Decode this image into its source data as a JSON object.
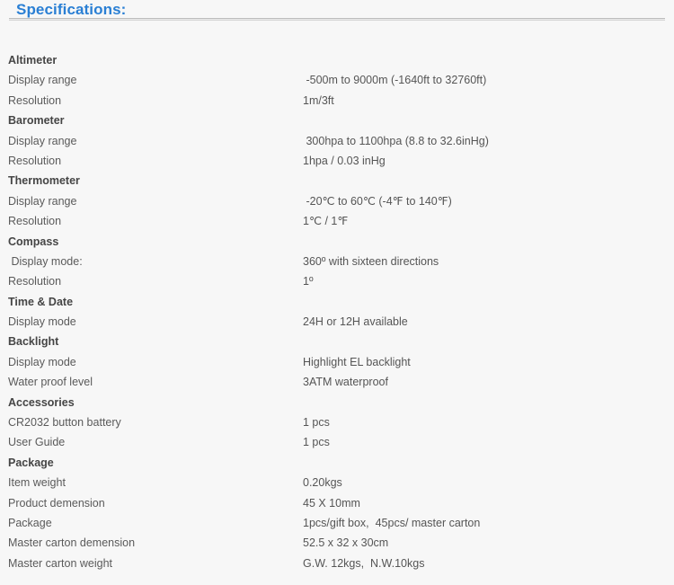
{
  "header": {
    "title": "Specifications:",
    "accent_color": "#2a7fd4",
    "rule_color": "#bdbdbd"
  },
  "colors": {
    "background": "#f7f7f7",
    "section_text": "#454545",
    "label_text": "#5a5a5a",
    "value_text": "#555555"
  },
  "spec_rows": [
    {
      "type": "section",
      "label": "Altimeter",
      "value": ""
    },
    {
      "type": "item",
      "label": "Display range",
      "value": " -500m to 9000m (-1640ft to 32760ft)"
    },
    {
      "type": "item",
      "label": "Resolution",
      "value": "1m/3ft"
    },
    {
      "type": "section",
      "label": "Barometer",
      "value": ""
    },
    {
      "type": "item",
      "label": "Display range",
      "value": " 300hpa to 1100hpa (8.8 to 32.6inHg)"
    },
    {
      "type": "item",
      "label": "Resolution",
      "value": "1hpa / 0.03 inHg"
    },
    {
      "type": "section",
      "label": "Thermometer",
      "value": ""
    },
    {
      "type": "item",
      "label": "Display range",
      "value": " -20℃ to 60℃ (-4℉ to 140℉)"
    },
    {
      "type": "item",
      "label": "Resolution",
      "value": "1℃ / 1℉"
    },
    {
      "type": "section",
      "label": "Compass",
      "value": ""
    },
    {
      "type": "item",
      "label": " Display mode:",
      "value": "360º with sixteen directions"
    },
    {
      "type": "item",
      "label": "Resolution",
      "value": "1º"
    },
    {
      "type": "section",
      "label": "Time & Date",
      "value": ""
    },
    {
      "type": "item",
      "label": "Display mode",
      "value": "24H or 12H available"
    },
    {
      "type": "section",
      "label": "Backlight",
      "value": ""
    },
    {
      "type": "item",
      "label": "Display mode",
      "value": "Highlight EL backlight"
    },
    {
      "type": "item",
      "label": "Water proof level",
      "value": "3ATM waterproof"
    },
    {
      "type": "section",
      "label": "Accessories",
      "value": ""
    },
    {
      "type": "item",
      "label": "CR2032 button battery",
      "value": "1 pcs"
    },
    {
      "type": "item",
      "label": "User Guide",
      "value": "1 pcs"
    },
    {
      "type": "section",
      "label": "Package",
      "value": ""
    },
    {
      "type": "item",
      "label": "Item weight",
      "value": "0.20kgs"
    },
    {
      "type": "item",
      "label": "Product demension",
      "value": "45 X 10mm"
    },
    {
      "type": "item",
      "label": "Package",
      "value": "1pcs/gift box,  45pcs/ master carton"
    },
    {
      "type": "item",
      "label": "Master carton demension",
      "value": "52.5 x 32 x 30cm"
    },
    {
      "type": "item",
      "label": "Master carton weight",
      "value": "G.W. 12kgs,  N.W.10kgs"
    }
  ]
}
